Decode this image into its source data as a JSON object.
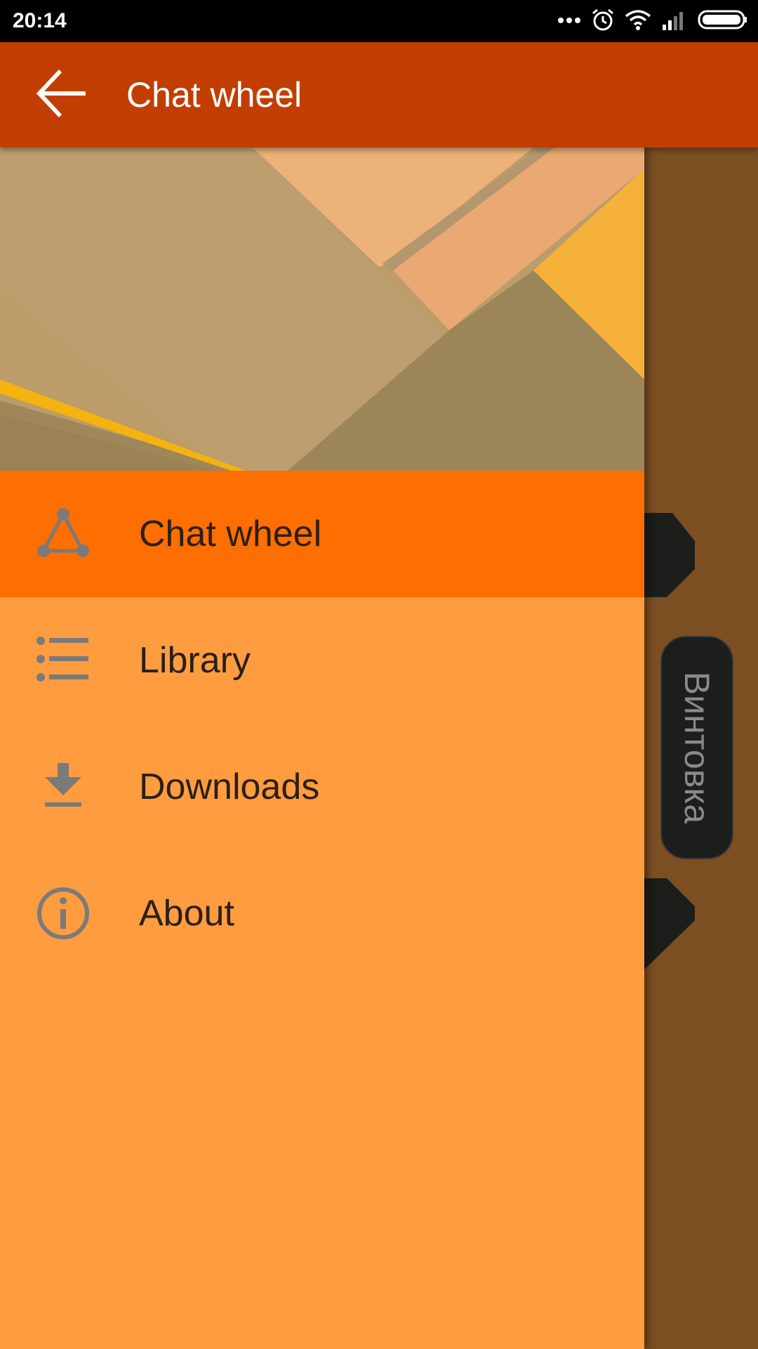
{
  "status_bar": {
    "time": "20:14",
    "icons": [
      "more-dots-icon",
      "alarm-icon",
      "wifi-icon",
      "signal-icon",
      "battery-icon"
    ]
  },
  "app_bar": {
    "title": "Chat wheel",
    "back_icon": "arrow-back-icon",
    "background_color": "#c23e00"
  },
  "drawer": {
    "background_color": "#ff9c40",
    "active_color": "#ff6e00",
    "items": [
      {
        "label": "Chat wheel",
        "icon": "triangle-nodes-icon",
        "active": true
      },
      {
        "label": "Library",
        "icon": "list-icon",
        "active": false
      },
      {
        "label": "Downloads",
        "icon": "download-icon",
        "active": false
      },
      {
        "label": "About",
        "icon": "info-icon",
        "active": false
      }
    ]
  },
  "background": {
    "tab_label": "Винтовка",
    "color": "#7c4f22"
  }
}
